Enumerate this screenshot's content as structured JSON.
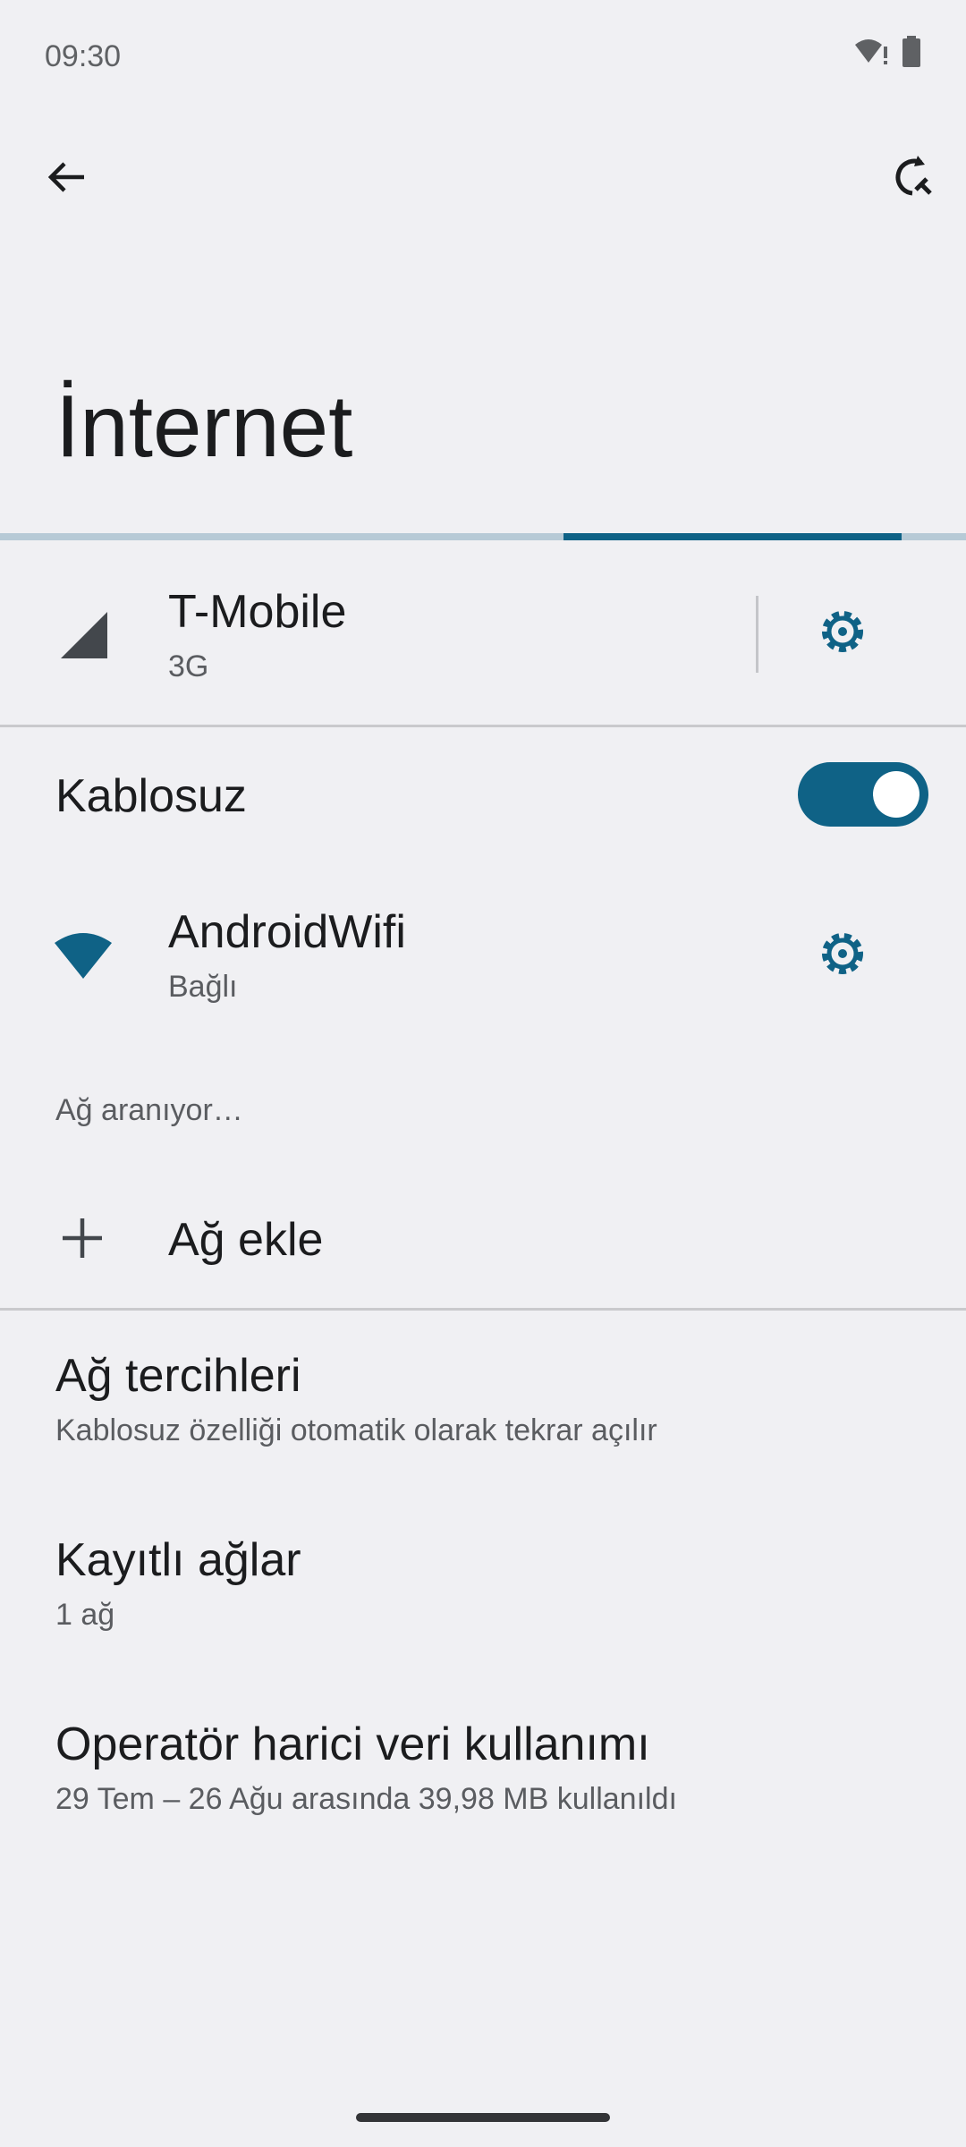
{
  "status_bar": {
    "time": "09:30",
    "icons": [
      "wifi-alert-icon",
      "battery-icon"
    ]
  },
  "top_bar": {
    "back_icon": "back-arrow-icon",
    "action_icon": "reset-network-icon"
  },
  "page": {
    "title": "İnternet",
    "progress": {
      "start_fraction": 0.5833,
      "end_fraction": 0.9333,
      "color": "#0f6286",
      "track_color": "#b7cad6"
    }
  },
  "mobile": {
    "icon": "cellular-signal-icon",
    "name": "T-Mobile",
    "network_type": "3G",
    "settings_icon": "gear-icon"
  },
  "wifi": {
    "label": "Kablosuz",
    "enabled": true,
    "toggle_color": "#0f6286",
    "connected": {
      "icon": "wifi-icon",
      "name": "AndroidWifi",
      "status": "Bağlı",
      "settings_icon": "gear-icon"
    },
    "searching_text": "Ağ aranıyor…",
    "add_network": {
      "icon": "plus-icon",
      "label": "Ağ ekle"
    }
  },
  "preferences": [
    {
      "title": "Ağ tercihleri",
      "subtitle": "Kablosuz özelliği otomatik olarak tekrar açılır"
    },
    {
      "title": "Kayıtlı ağlar",
      "subtitle": "1 ağ"
    },
    {
      "title": "Operatör harici veri kullanımı",
      "subtitle": "29 Tem – 26 Ağu arasında 39,98 MB kullanıldı"
    }
  ],
  "accent_color": "#0f6286"
}
